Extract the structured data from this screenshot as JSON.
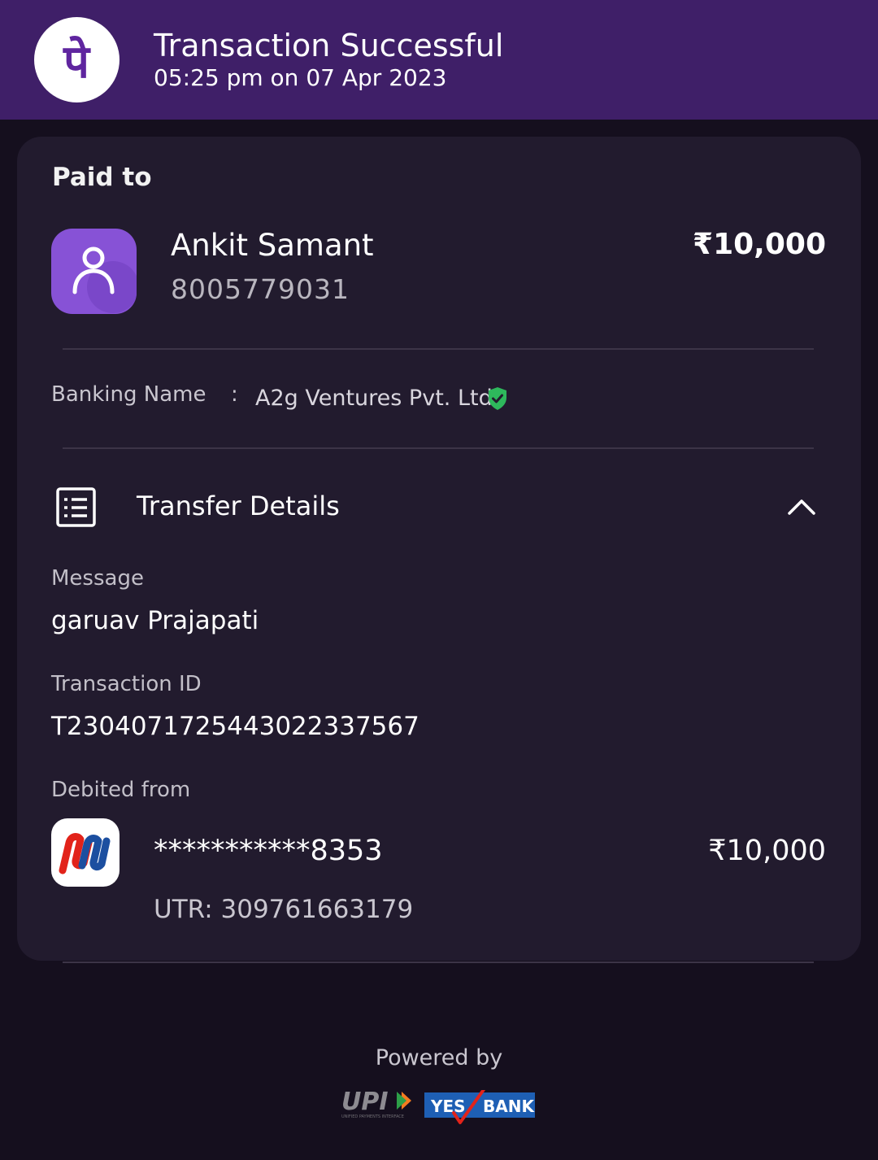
{
  "header": {
    "title": "Transaction Successful",
    "datetime": "05:25 pm on 07 Apr 2023",
    "app_logo_glyph": "पे",
    "app_logo_icon": "phonepe-logo-icon"
  },
  "paid_to": {
    "label": "Paid to",
    "name": "Ankit Samant",
    "phone": "8005779031",
    "amount": "₹10,000",
    "avatar_icon": "person-icon"
  },
  "banking": {
    "label": "Banking Name",
    "separator": ":",
    "name": "A2g Ventures Pvt. Ltd.",
    "verified_icon": "verified-shield-icon"
  },
  "transfer_details": {
    "title": "Transfer Details",
    "icon": "receipt-list-icon",
    "toggle_icon": "chevron-up-icon",
    "message_label": "Message",
    "message_value": "garuav Prajapati",
    "txn_label": "Transaction ID",
    "txn_value": "T2304071725443022337567",
    "debited_label": "Debited from",
    "account_masked": "***********8353",
    "debit_amount": "₹10,000",
    "utr": "UTR: 309761663179",
    "bank_icon": "union-bank-logo-icon"
  },
  "footer": {
    "powered_by": "Powered by",
    "upi_text": "UPI",
    "upi_tagline": "UNIFIED PAYMENTS INTERFACE",
    "bank_word_1": "YES",
    "bank_word_2": "BANK"
  },
  "colors": {
    "header_bg": "#3f1f68",
    "page_bg": "#150f1e",
    "card_bg": "#221b2e",
    "avatar_bg": "#8752d6",
    "verified_green": "#2eb85c",
    "yes_bank_blue": "#1e5fb4",
    "yes_bank_red": "#e2231a"
  }
}
